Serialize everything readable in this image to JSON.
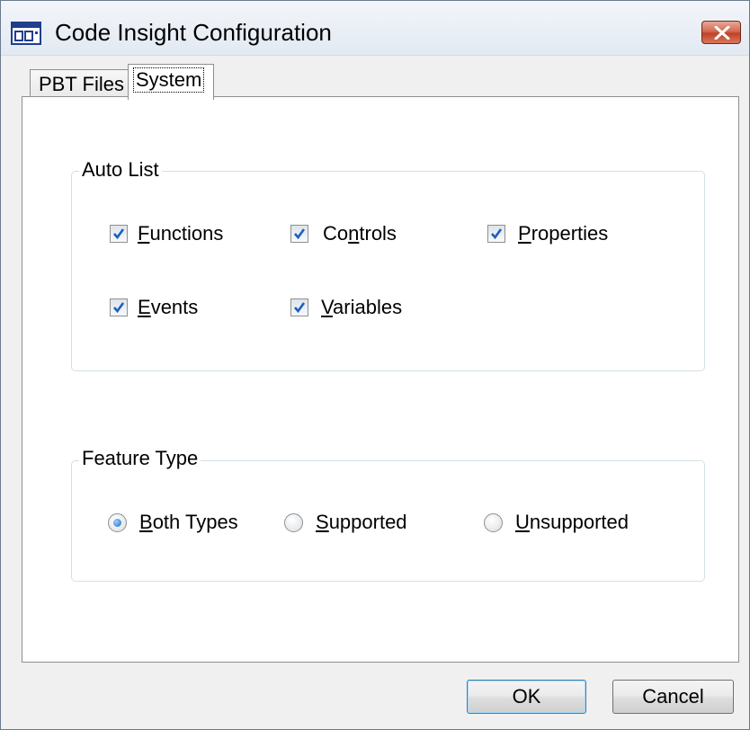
{
  "window": {
    "title": "Code Insight Configuration"
  },
  "tabs": [
    {
      "label": "PBT Files",
      "active": false
    },
    {
      "label": "System",
      "active": true
    }
  ],
  "auto_list": {
    "legend": "Auto List",
    "options": [
      {
        "key": "F",
        "rest": "unctions",
        "checked": true
      },
      {
        "pre": "Co",
        "key": "n",
        "rest": "trols",
        "checked": true
      },
      {
        "key": "P",
        "rest": "roperties",
        "checked": true
      },
      {
        "key": "E",
        "rest": "vents",
        "checked": true
      },
      {
        "key": "V",
        "rest": "ariables",
        "checked": true
      }
    ]
  },
  "feature_type": {
    "legend": "Feature Type",
    "options": [
      {
        "key": "B",
        "rest": "oth Types",
        "selected": true
      },
      {
        "key": "S",
        "rest": "upported",
        "selected": false
      },
      {
        "key": "U",
        "rest": "nsupported",
        "selected": false
      }
    ]
  },
  "buttons": {
    "ok": "OK",
    "cancel": "Cancel"
  },
  "colors": {
    "check": "#1d5fbf",
    "radio_dot": "#1b67c7",
    "close_button": "#c04327"
  },
  "icons": {
    "app": "window-icon",
    "close": "close-icon",
    "check": "checkmark-icon"
  }
}
